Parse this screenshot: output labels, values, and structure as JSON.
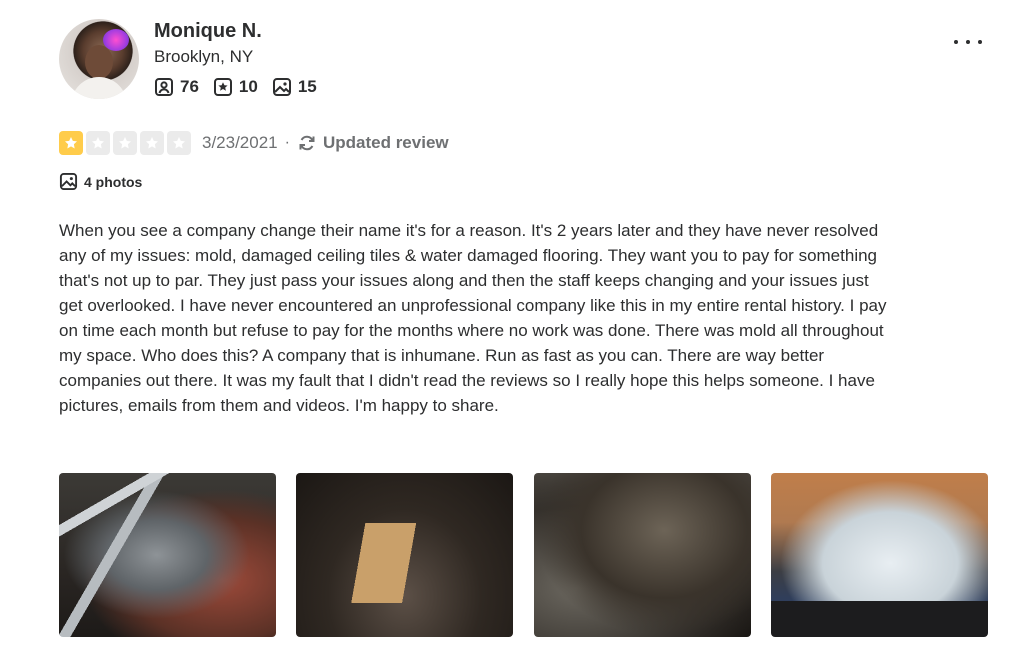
{
  "user": {
    "name": "Monique N.",
    "location": "Brooklyn, NY",
    "friends_count": "76",
    "reviews_count": "10",
    "photos_count": "15"
  },
  "review": {
    "rating": 1,
    "rating_max": 5,
    "date": "3/23/2021",
    "separator": "·",
    "updated_label": "Updated review",
    "photos_label": "4 photos",
    "text": "When you see a company change their name it's for a reason. It's 2 years later and they have never resolved any of my issues: mold, damaged ceiling tiles & water damaged flooring. They want you to pay for something that's not up to par. They just pass your issues along and then the staff keeps changing and your issues just get overlooked. I have never encountered an unprofessional company like this in my entire rental history. I pay on time each month but refuse to pay for the months where no work was done. There was mold all throughout my space. Who does this? A company that is inhumane. Run as fast as you can. There are way better companies out there. It was my fault that I didn't read the reviews so I really hope this helps someone. I have pictures, emails from them and videos. I'm happy to share."
  },
  "colors": {
    "star_on": "#ffcc4b",
    "star_off": "#ebebeb",
    "text": "#2d2e2f",
    "muted": "#6e7072"
  },
  "icons": [
    "friends-icon",
    "reviews-icon",
    "photos-icon",
    "more-options-icon",
    "star-icon",
    "refresh-icon",
    "photo-icon"
  ]
}
